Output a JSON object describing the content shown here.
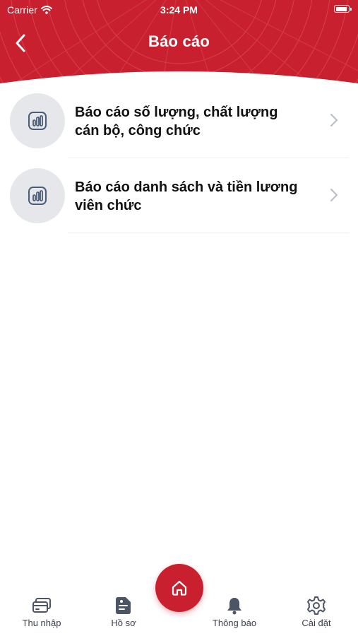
{
  "status_bar": {
    "carrier": "Carrier",
    "time": "3:24 PM"
  },
  "header": {
    "title": "Báo cáo",
    "back_icon": "chevron-left-icon"
  },
  "colors": {
    "brand_red": "#c8202f",
    "icon_bg": "#e6e7eb",
    "icon_stroke": "#4b5d7a"
  },
  "reports": [
    {
      "label_line1": "Báo cáo số lượng, chất lượng",
      "label_line2": "cán bộ, công chức",
      "icon": "report-chart-icon"
    },
    {
      "label_line1": "Báo cáo danh sách và tiền lương",
      "label_line2": "viên chức",
      "icon": "report-chart-icon"
    }
  ],
  "tabbar": {
    "tabs": [
      {
        "label": "Thu nhập",
        "icon": "card-icon"
      },
      {
        "label": "Hồ sơ",
        "icon": "document-icon"
      },
      {
        "label": "Thông báo",
        "icon": "bell-icon"
      },
      {
        "label": "Cài đặt",
        "icon": "gear-icon"
      }
    ],
    "center_icon": "home-icon"
  }
}
